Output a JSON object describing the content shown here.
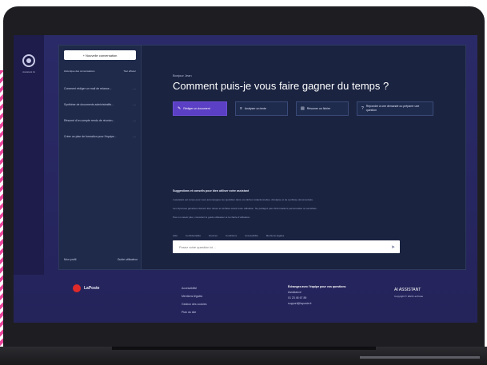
{
  "rail": {
    "label": "Assistant IA"
  },
  "sidebar": {
    "new_button": "+ Nouvelle conversation",
    "header_left": "Historique des conversations",
    "header_right": "Tout effacer",
    "items": [
      {
        "label": "Comment rédiger un mail de relance..."
      },
      {
        "label": "Synthèse de documents administratifs..."
      },
      {
        "label": "Résumé d'un compte rendu de réunion..."
      },
      {
        "label": "Créer un plan de formation pour l'équipe..."
      }
    ],
    "footer_left": "Mon profil",
    "footer_right": "Guide utilisateur"
  },
  "main": {
    "breadcrumb": "Bonjour Jean",
    "headline": "Comment puis-je vous faire gagner du temps ?",
    "actions": [
      {
        "label": "Rédiger un document",
        "icon": "pen-icon"
      },
      {
        "label": "Analyser un texte",
        "icon": "text-icon"
      },
      {
        "label": "Résumer un fichier",
        "icon": "file-icon"
      },
      {
        "label": "Répondre à une demande ou préparer une question",
        "icon": "question-icon"
      }
    ],
    "notice": {
      "title": "Suggestions et conseils pour bien utiliser votre assistant",
      "lines": [
        "L'assistant est conçu pour vous accompagner au quotidien dans vos tâches rédactionnelles, d'analyse et de synthèse documentaire.",
        "Les réponses générées doivent être relues et vérifiées avant toute utilisation. Ne partagez pas d'informations personnelles ou sensibles.",
        "Pour en savoir plus, consultez le guide utilisateur et la charte d'utilisation."
      ]
    },
    "chips": [
      "Aide",
      "Confidentialité",
      "Sources",
      "Conditions",
      "Accessibilité",
      "Mentions légales"
    ],
    "prompt": {
      "placeholder": "Posez votre question ici…",
      "send_icon": "send-icon"
    }
  },
  "footer": {
    "logo_text": "LaPoste",
    "links": [
      "Accessibilité",
      "Mentions légales",
      "Gestion des cookies",
      "Plan du site"
    ],
    "contact_title": "Échangez avec l'équipe pour vos questions",
    "contact_lines": [
      "Assistance",
      "01 23 45 67 89",
      "support@laposte.fr"
    ],
    "brand_title": "AI ASSISTANT",
    "brand_sub": "Copyright © 2024 La Poste"
  },
  "colors": {
    "accent": "#5b3fc4",
    "screen_bg": "#24235a",
    "panel_bg": "#1a2340",
    "logo": "#e02a2a",
    "stripe": "#e8449a"
  }
}
